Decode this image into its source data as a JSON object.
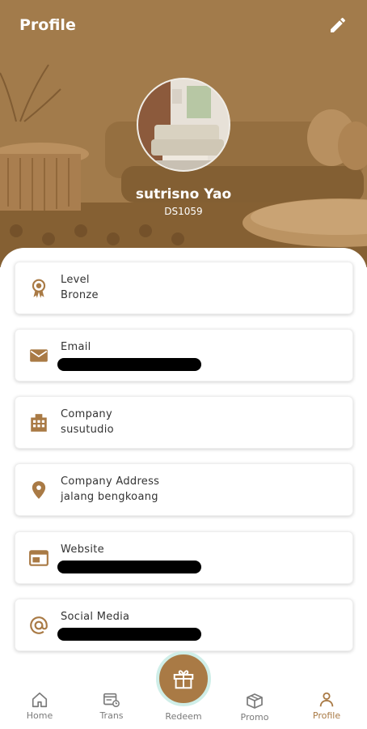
{
  "header": {
    "title": "Profile",
    "edit_icon": "pencil-icon"
  },
  "user": {
    "name": "sutrisno Yao",
    "id": "DS1059"
  },
  "fields": [
    {
      "label": "Level",
      "value": "Bronze",
      "icon": "badge-icon"
    },
    {
      "label": "Email",
      "value": "",
      "icon": "mail-icon",
      "redacted": true
    },
    {
      "label": "Company",
      "value": "susutudio",
      "icon": "building-icon"
    },
    {
      "label": "Company Address",
      "value": "jalang bengkoang",
      "icon": "location-pin-icon"
    },
    {
      "label": "Website",
      "value": "",
      "icon": "web-icon",
      "redacted": true
    },
    {
      "label": "Social Media",
      "value": "",
      "icon": "at-icon",
      "redacted": true
    }
  ],
  "nav": {
    "items": [
      {
        "label": "Home",
        "icon": "home-icon"
      },
      {
        "label": "Trans",
        "icon": "transaction-icon"
      },
      {
        "label": "Redeem",
        "icon": "gift-icon"
      },
      {
        "label": "Promo",
        "icon": "promo-box-icon"
      },
      {
        "label": "Profile",
        "icon": "person-icon",
        "active": true
      }
    ]
  },
  "colors": {
    "accent": "#a97a45",
    "header_bg": "#b08452",
    "fab_ring": "#cfeee8"
  }
}
